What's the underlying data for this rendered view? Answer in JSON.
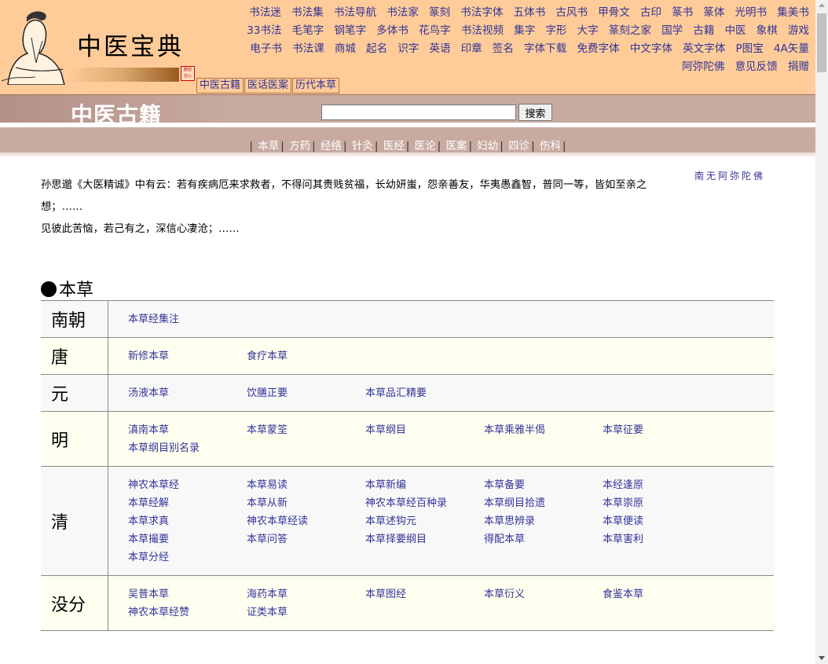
{
  "header": {
    "logo_title": "中医宝典",
    "seal_text": "觀自在心",
    "top_links": [
      "书法迷",
      "书法集",
      "书法导航",
      "书法家",
      "篆刻",
      "书法字体",
      "五体书",
      "古风书",
      "甲骨文",
      "古印",
      "篆书",
      "篆体",
      "光明书",
      "集美书",
      "33书法",
      "毛笔字",
      "钢笔字",
      "多体书",
      "花鸟字",
      "书法视频",
      "集字",
      "字形",
      "大字",
      "篆刻之家",
      "国学",
      "古籍",
      "中医",
      "象棋",
      "游戏",
      "电子书",
      "书法课",
      "商城",
      "起名",
      "识字",
      "英语",
      "印章",
      "签名",
      "字体下载",
      "免费字体",
      "中文字体",
      "英文字体",
      "P图宝",
      "4A矢量",
      "阿弥陀佛",
      "意见反馈",
      "捐赠"
    ],
    "sub_tabs": [
      "中医古籍",
      "医话医案",
      "历代本草"
    ]
  },
  "titlebar": {
    "title": "中医古籍",
    "search_placeholder": "",
    "search_button": "搜索"
  },
  "nav": {
    "items": [
      "本草",
      "方药",
      "经络",
      "针灸",
      "医经",
      "医论",
      "医案",
      "妇幼",
      "四诊",
      "伤科"
    ]
  },
  "intro": {
    "line1": "孙思邈《大医精诚》中有云：若有疾病厄来求救者，不得问其贵贱贫福，长幼妍蚩，怨亲善友，华夷愚鑫智，普同一等，皆如至亲之想；……",
    "line2": "见彼此苦恼，若己有之，深信心凄沧；……",
    "namo": "南无阿弥陀佛"
  },
  "section": {
    "title": "本草",
    "rows": [
      {
        "era": "南朝",
        "books": [
          "本草经集注"
        ]
      },
      {
        "era": "唐",
        "books": [
          "新修本草",
          "食疗本草"
        ]
      },
      {
        "era": "元",
        "books": [
          "汤液本草",
          "饮膳正要",
          "本草品汇精要"
        ]
      },
      {
        "era": "明",
        "books": [
          "滇南本草",
          "本草蒙筌",
          "本草纲目",
          "本草乘雅半偈",
          "本草征要",
          "本草纲目别名录"
        ]
      },
      {
        "era": "清",
        "books": [
          "神农本草经",
          "本草易读",
          "本草新编",
          "本草备要",
          "本经逢原",
          "本草经解",
          "本草从新",
          "神农本草经百种录",
          "本草纲目拾遗",
          "本草崇原",
          "本草求真",
          "神农本草经读",
          "本草述钩元",
          "本草思辨录",
          "本草便读",
          "本草撮要",
          "本草问答",
          "本草择要纲目",
          "得配本草",
          "本草害利",
          "本草分经"
        ]
      },
      {
        "era": "没分",
        "books": [
          "吴普本草",
          "海药本草",
          "本草图经",
          "本草衍义",
          "食鉴本草",
          "神农本草经赞",
          "证类本草"
        ]
      }
    ]
  },
  "colors": {
    "header_bg": "#ffcc99",
    "band_bg": "#c8aaa0",
    "link": "#333399",
    "row_alt": "#fffff0"
  }
}
